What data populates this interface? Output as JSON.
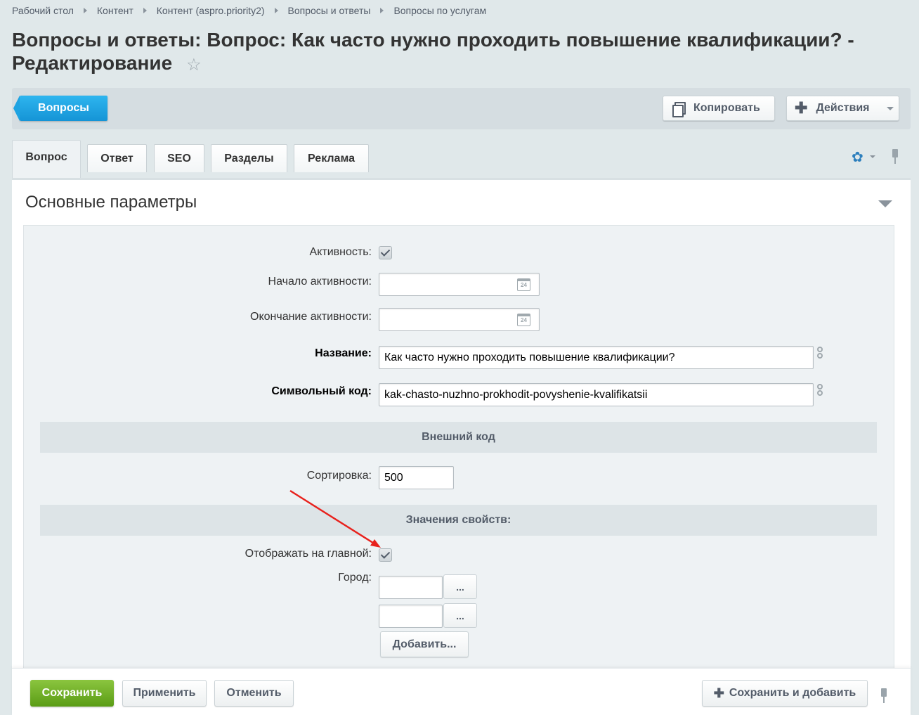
{
  "breadcrumb": [
    "Рабочий стол",
    "Контент",
    "Контент (aspro.priority2)",
    "Вопросы и ответы",
    "Вопросы по услугам"
  ],
  "page": {
    "title": "Вопросы и ответы: Вопрос: Как часто нужно проходить повышение квалификации? - Редактирование",
    "star_glyph": "☆"
  },
  "toolbar": {
    "back_label": "Вопросы",
    "copy_label": "Копировать",
    "actions_label": "Действия",
    "plus_glyph": "✚"
  },
  "tabs": [
    "Вопрос",
    "Ответ",
    "SEO",
    "Разделы",
    "Реклама"
  ],
  "tabs_settings_glyph": "✿",
  "section": {
    "title": "Основные параметры"
  },
  "form": {
    "active_label": "Активность:",
    "active_checked": true,
    "start_label": "Начало активности:",
    "start_value": "",
    "end_label": "Окончание активности:",
    "end_value": "",
    "calendar_day": "24",
    "name_label": "Название:",
    "name_value": "Как часто нужно проходить повышение квалификации?",
    "code_label": "Символьный код:",
    "code_value": "kak-chasto-nuzhno-prokhodit-povyshenie-kvalifikatsii",
    "external_code_header": "Внешний код",
    "sort_label": "Сортировка:",
    "sort_value": "500",
    "properties_header": "Значения свойств:",
    "show_main_label": "Отображать на главной:",
    "show_main_checked": true,
    "city_label": "Город:",
    "city_values": [
      "",
      ""
    ],
    "dots_label": "...",
    "add_label": "Добавить..."
  },
  "footer": {
    "save_label": "Сохранить",
    "apply_label": "Применить",
    "cancel_label": "Отменить",
    "save_add_label": "Сохранить и добавить"
  },
  "annotation_color": "#e8211c"
}
